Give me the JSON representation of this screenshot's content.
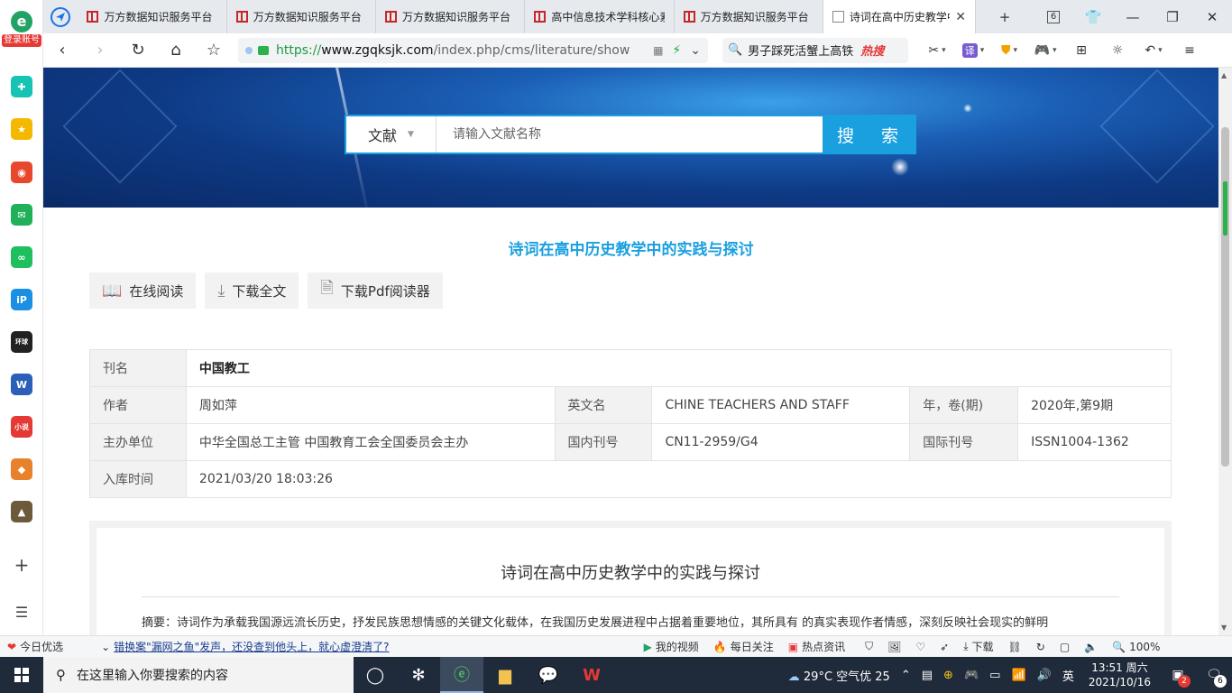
{
  "sidebar": {
    "account_label": "登录账号"
  },
  "tabs": [
    {
      "title": "万方数据知识服务平台"
    },
    {
      "title": "万方数据知识服务平台"
    },
    {
      "title": "万方数据知识服务平台"
    },
    {
      "title": "高中信息技术学科核心素养"
    },
    {
      "title": "万方数据知识服务平台"
    },
    {
      "title": "诗词在高中历史教学中的实践与探讨"
    }
  ],
  "tab_count": "6",
  "address": {
    "scheme": "https://",
    "host": "www.zgqksjk.com",
    "path": "/index.php/cms/literature/show"
  },
  "search_box": {
    "text": "男子踩死活蟹上高铁",
    "hot_label": "热搜"
  },
  "extensions": {
    "translate_label": "译"
  },
  "page": {
    "search": {
      "category": "文献",
      "placeholder": "请输入文献名称",
      "button": "搜 索"
    },
    "title": "诗词在高中历史教学中的实践与探讨",
    "actions": {
      "read_online": "在线阅读",
      "download_full": "下载全文",
      "download_pdf_reader": "下载Pdf阅读器"
    },
    "meta": {
      "journal_label": "刊名",
      "journal_value": "中国教工",
      "author_label": "作者",
      "author_value": "周如萍",
      "english_name_label": "英文名",
      "english_name_value": "CHINE TEACHERS AND STAFF",
      "year_issue_label": "年，卷(期)",
      "year_issue_value": "2020年,第9期",
      "sponsor_label": "主办单位",
      "sponsor_value": "中华全国总工主管 中国教育工会全国委员会主办",
      "cn_label": "国内刊号",
      "cn_value": "CN11-2959/G4",
      "issn_label": "国际刊号",
      "issn_value": "ISSN1004-1362",
      "date_label": "入库时间",
      "date_value": "2021/03/20 18:03:26"
    },
    "abstract": {
      "heading": "诗词在高中历史教学中的实践与探讨",
      "text": "摘要：诗词作为承载我国源远流长历史，抒发民族思想情感的关键文化载体，在我国历史发展进程中占据着重要地位，其所具有 的真实表现作者情感，深刻反映社会现实的鲜明"
    }
  },
  "statusbar": {
    "today": "今日优选",
    "news": "错换案\"漏网之鱼\"发声，还没查到他头上，就心虚澄清了?",
    "video": "我的视频",
    "daily": "每日关注",
    "hot": "热点资讯",
    "download": "下载",
    "zoom": "100%"
  },
  "taskbar": {
    "search_placeholder": "在这里输入你要搜索的内容",
    "weather": "29°C  空气优 25",
    "ime": "英",
    "time": "13:51 周六",
    "date": "2021/10/16",
    "mail_badge": "2",
    "notif_badge": "6"
  }
}
